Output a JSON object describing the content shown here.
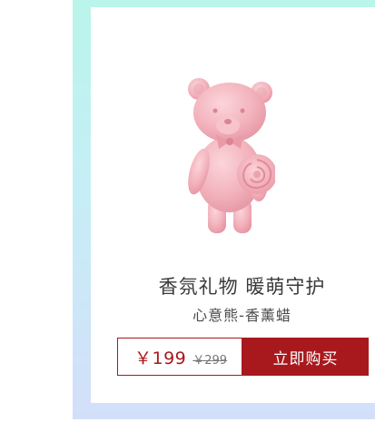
{
  "product": {
    "title": "香氛礼物 暖萌守护",
    "subtitle": "心意熊-香薰蜡",
    "image_icon": "pink-bear-candle-icon",
    "price": {
      "current": "￥199",
      "original": "￥299"
    },
    "buy_label": "立即购买"
  },
  "colors": {
    "accent": "#a8191d",
    "frame_top": "#b9f5ea",
    "frame_bottom": "#d3dff9",
    "bear_pink": "#f4b7c0"
  }
}
